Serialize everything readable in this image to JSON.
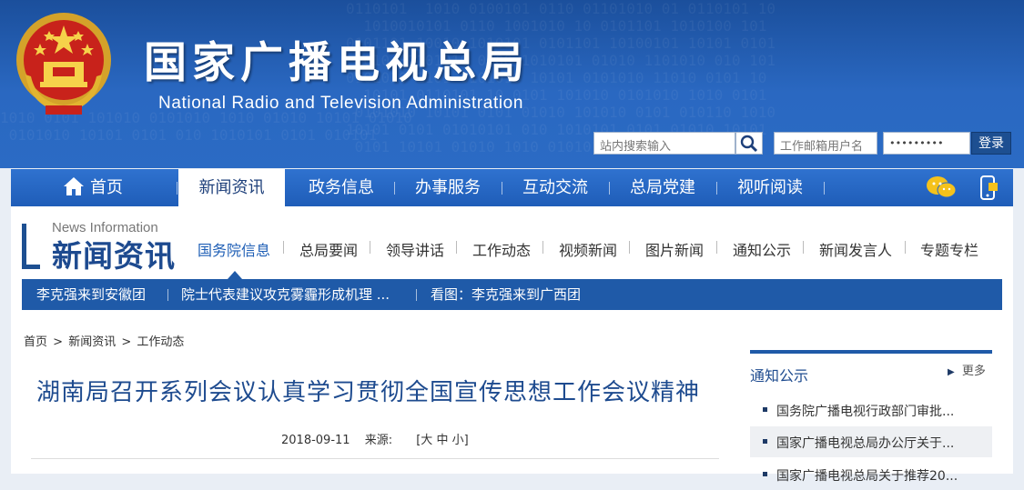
{
  "header": {
    "title": "国家广播电视总局",
    "subtitle": "National Radio and Television Administration",
    "search_placeholder": "站内搜索输入",
    "email_placeholder": "工作邮箱用户名",
    "password_mask": "•••••••••",
    "login_label": "登录"
  },
  "nav": {
    "items": [
      {
        "label": "首页"
      },
      {
        "label": "新闻资讯"
      },
      {
        "label": "政务信息"
      },
      {
        "label": "办事服务"
      },
      {
        "label": "互动交流"
      },
      {
        "label": "总局党建"
      },
      {
        "label": "视听阅读"
      }
    ],
    "active_index": 1
  },
  "news_section": {
    "label_en": "News Information",
    "label_cn": "新闻资讯",
    "subnav": [
      "国务院信息",
      "总局要闻",
      "领导讲话",
      "工作动态",
      "视频新闻",
      "图片新闻",
      "通知公示",
      "新闻发言人",
      "专题专栏"
    ],
    "ticker": [
      "李克强来到安徽团",
      "院士代表建议攻克雾霾形成机理 ...",
      "看图：李克强来到广西团"
    ]
  },
  "breadcrumb": [
    "首页",
    "新闻资讯",
    "工作动态"
  ],
  "breadcrumb_sep": ">",
  "article": {
    "title": "湖南局召开系列会议认真学习贯彻全国宣传思想工作会议精神",
    "date": "2018-09-11",
    "source_label": "来源:",
    "font_size_label": "[大 中 小]"
  },
  "sidebar": {
    "title": "通知公示",
    "more": "更多",
    "items": [
      "国务院广播电视行政部门审批...",
      "国家广播电视总局办公厅关于...",
      "国家广播电视总局关于推荐20..."
    ]
  },
  "colors": {
    "brand_blue": "#1f5aa8",
    "header_blue": "#2a68c1",
    "title_blue": "#1e4b8f"
  }
}
